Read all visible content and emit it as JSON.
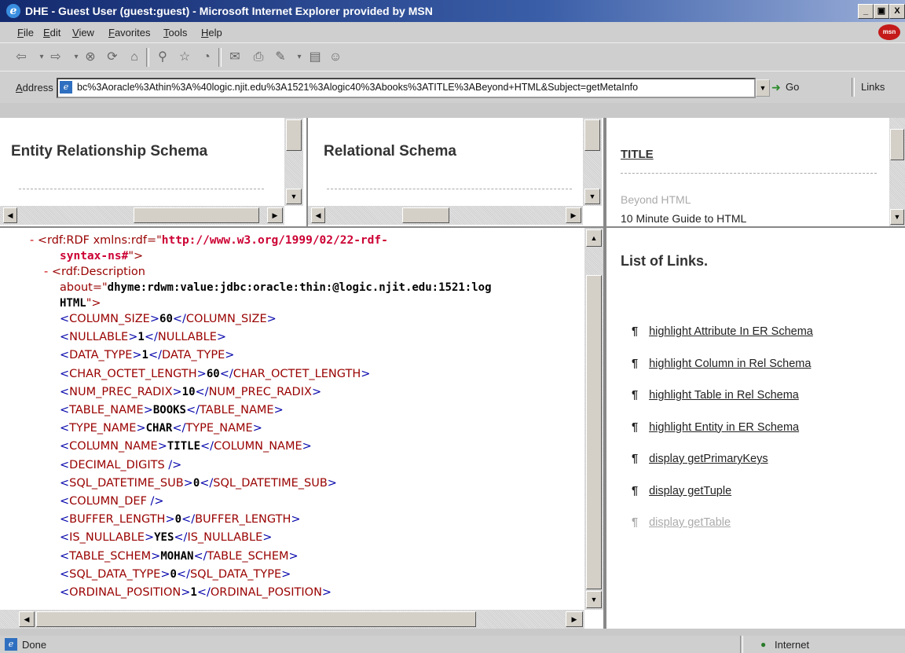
{
  "window": {
    "title": "DHE - Guest User (guest:guest) - Microsoft Internet Explorer provided by MSN",
    "minimize": "_",
    "maximize": "▣",
    "close": "X"
  },
  "menu": [
    "File",
    "Edit",
    "View",
    "Favorites",
    "Tools",
    "Help"
  ],
  "msn_logo": "msn",
  "address": {
    "label": "Address",
    "url": "bc%3Aoracle%3Athin%3A%40logic.njit.edu%3A1521%3Alogic40%3Abooks%3ATITLE%3ABeyond+HTML&Subject=getMetaInfo",
    "go": "Go",
    "links": "Links"
  },
  "frames": {
    "er": {
      "title": "Entity Relationship Schema"
    },
    "rel": {
      "title": "Relational Schema"
    },
    "data": {
      "heading": "TITLE",
      "values": [
        "Beyond HTML",
        "10 Minute Guide to HTML"
      ]
    }
  },
  "xml": {
    "rdf_open": "<rdf:RDF xmlns:rdf=\"",
    "rdf_ns_a": "http://www.w3.org/1999/02/22-rdf-",
    "rdf_ns_b": "syntax-ns#",
    "rdf_close": "\">",
    "desc_open": "<rdf:Description",
    "about_attr": "about=\"",
    "about_val": "dhyme:rdwm:value:jdbc:oracle:thin:@logic.njit.edu:1521:log",
    "about_cont": "HTML",
    "about_end": "\">",
    "elements": [
      {
        "name": "COLUMN_SIZE",
        "value": "60"
      },
      {
        "name": "NULLABLE",
        "value": "1"
      },
      {
        "name": "DATA_TYPE",
        "value": "1"
      },
      {
        "name": "CHAR_OCTET_LENGTH",
        "value": "60"
      },
      {
        "name": "NUM_PREC_RADIX",
        "value": "10"
      },
      {
        "name": "TABLE_NAME",
        "value": "BOOKS"
      },
      {
        "name": "TYPE_NAME",
        "value": "CHAR"
      },
      {
        "name": "COLUMN_NAME",
        "value": "TITLE"
      },
      {
        "name": "DECIMAL_DIGITS",
        "value": ""
      },
      {
        "name": "SQL_DATETIME_SUB",
        "value": "0"
      },
      {
        "name": "COLUMN_DEF",
        "value": ""
      },
      {
        "name": "BUFFER_LENGTH",
        "value": "0"
      },
      {
        "name": "IS_NULLABLE",
        "value": "YES"
      },
      {
        "name": "TABLE_SCHEM",
        "value": "MOHAN"
      },
      {
        "name": "SQL_DATA_TYPE",
        "value": "0"
      },
      {
        "name": "ORDINAL_POSITION",
        "value": "1"
      }
    ]
  },
  "links_panel": {
    "title": "List of Links.",
    "pilcrow": "¶",
    "items": [
      "highlight Attribute In ER Schema",
      "highlight Column in Rel Schema",
      "highlight Table in Rel Schema",
      "highlight Entity in ER Schema",
      "display getPrimaryKeys",
      "display getTuple",
      "display getTable"
    ]
  },
  "status": {
    "left": "Done",
    "zone": "Internet"
  }
}
